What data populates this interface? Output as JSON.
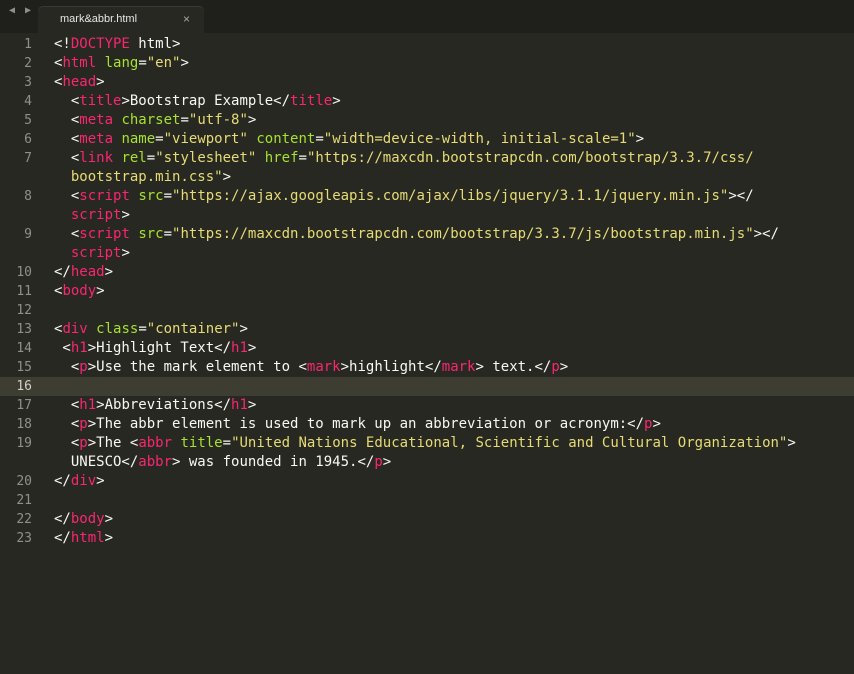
{
  "tab": {
    "title": "mark&abbr.html",
    "close": "×"
  },
  "nav": {
    "back": "◀",
    "forward": "▶"
  },
  "line_numbers": [
    "1",
    "2",
    "3",
    "4",
    "5",
    "6",
    "7",
    "8",
    "9",
    "10",
    "11",
    "12",
    "13",
    "14",
    "15",
    "16",
    "17",
    "18",
    "19",
    "20",
    "21",
    "22",
    "23"
  ],
  "current_line": "16",
  "code": {
    "l1": [
      "<!",
      "DOCTYPE",
      " html>"
    ],
    "l2": [
      "<",
      "html",
      " ",
      "lang",
      "=",
      "\"en\"",
      ">"
    ],
    "l3": [
      "<",
      "head",
      ">"
    ],
    "l4": [
      "  <",
      "title",
      ">Bootstrap Example</",
      "title",
      ">"
    ],
    "l5": [
      "  <",
      "meta",
      " ",
      "charset",
      "=",
      "\"utf-8\"",
      ">"
    ],
    "l6": [
      "  <",
      "meta",
      " ",
      "name",
      "=",
      "\"viewport\"",
      " ",
      "content",
      "=",
      "\"width=device-width, initial-scale=1\"",
      ">"
    ],
    "l7a": [
      "  <",
      "link",
      " ",
      "rel",
      "=",
      "\"stylesheet\"",
      " ",
      "href",
      "=",
      "\"https://maxcdn.bootstrapcdn.com/bootstrap/3.3.7/css/"
    ],
    "l7b": [
      "  bootstrap.min.css\"",
      ">"
    ],
    "l8a": [
      "  <",
      "script",
      " ",
      "src",
      "=",
      "\"https://ajax.googleapis.com/ajax/libs/jquery/3.1.1/jquery.min.js\"",
      "></"
    ],
    "l8b": [
      "  ",
      "script",
      ">"
    ],
    "l9a": [
      "  <",
      "script",
      " ",
      "src",
      "=",
      "\"https://maxcdn.bootstrapcdn.com/bootstrap/3.3.7/js/bootstrap.min.js\"",
      "></"
    ],
    "l9b": [
      "  ",
      "script",
      ">"
    ],
    "l10": [
      "</",
      "head",
      ">"
    ],
    "l11": [
      "<",
      "body",
      ">"
    ],
    "l13": [
      "<",
      "div",
      " ",
      "class",
      "=",
      "\"container\"",
      ">"
    ],
    "l14": [
      " <",
      "h1",
      ">Highlight Text</",
      "h1",
      ">"
    ],
    "l15": [
      "  <",
      "p",
      ">Use the mark element to <",
      "mark",
      ">highlight</",
      "mark",
      "> text.</",
      "p",
      ">"
    ],
    "l17": [
      "  <",
      "h1",
      ">Abbreviations</",
      "h1",
      ">"
    ],
    "l18": [
      "  <",
      "p",
      ">The abbr element is used to mark up an abbreviation or acronym:</",
      "p",
      ">"
    ],
    "l19a": [
      "  <",
      "p",
      ">The <",
      "abbr",
      " ",
      "title",
      "=",
      "\"United Nations Educational, Scientific and Cultural Organization\"",
      ">"
    ],
    "l19b": [
      "  UNESCO</",
      "abbr",
      "> was founded in 1945.</",
      "p",
      ">"
    ],
    "l20": [
      "</",
      "div",
      ">"
    ],
    "l22": [
      "</",
      "body",
      ">"
    ],
    "l23": [
      "</",
      "html",
      ">"
    ]
  },
  "colors": {
    "background": "#272822",
    "tag": "#f92672",
    "attribute": "#a6e22e",
    "string": "#e6db74",
    "text": "#f8f8f2",
    "gutter": "#90908a",
    "current_line": "#3e3d32"
  }
}
